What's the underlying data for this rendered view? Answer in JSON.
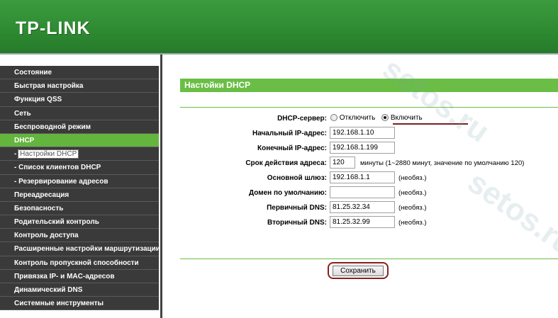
{
  "header": {
    "logo": "TP-LINK"
  },
  "sidebar": {
    "items": [
      {
        "label": "Состояние",
        "active": false
      },
      {
        "label": "Быстрая настройка",
        "active": false
      },
      {
        "label": "Функция QSS",
        "active": false
      },
      {
        "label": "Сеть",
        "active": false
      },
      {
        "label": "Беспроводной режим",
        "active": false
      },
      {
        "label": "DHCP",
        "active": true
      },
      {
        "label": "- Настройки DHCP",
        "active": false,
        "sub": true,
        "selected": true
      },
      {
        "label": "- Список клиентов DHCP",
        "active": false,
        "sub": true
      },
      {
        "label": "- Резервирование адресов",
        "active": false,
        "sub": true
      },
      {
        "label": "Переадресация",
        "active": false
      },
      {
        "label": "Безопасность",
        "active": false
      },
      {
        "label": "Родительский контроль",
        "active": false
      },
      {
        "label": "Контроль доступа",
        "active": false
      },
      {
        "label": "Расширенные настройки маршрутизации",
        "active": false
      },
      {
        "label": "Контроль пропускной способности",
        "active": false
      },
      {
        "label": "Привязка IP- и MAC-адресов",
        "active": false
      },
      {
        "label": "Динамический DNS",
        "active": false
      },
      {
        "label": "Системные инструменты",
        "active": false
      }
    ]
  },
  "main": {
    "title": "Настойки DHCP",
    "dhcp_server": {
      "label": "DHCP-сервер:",
      "off_label": "Отключить",
      "on_label": "Включить",
      "selected": "on"
    },
    "fields": {
      "start_ip": {
        "label": "Начальный IP-адрес:",
        "value": "192.168.1.10"
      },
      "end_ip": {
        "label": "Конечный IP-адрес:",
        "value": "192.168.1.199"
      },
      "lease": {
        "label": "Срок действия адреса:",
        "value": "120",
        "note": "минуты (1~2880 минут, значение по умолчанию 120)"
      },
      "gateway": {
        "label": "Основной шлюз:",
        "value": "192.168.1.1",
        "note": "(необяз.)"
      },
      "domain": {
        "label": "Домен по умолчанию:",
        "value": "",
        "note": "(необяз.)"
      },
      "dns1": {
        "label": "Первичный DNS:",
        "value": "81.25.32.34",
        "note": "(необяз.)"
      },
      "dns2": {
        "label": "Вторичный DNS:",
        "value": "81.25.32.99",
        "note": "(необяз.)"
      }
    },
    "save_label": "Сохранить"
  },
  "watermark": "setos.ru",
  "colors": {
    "header": "#2f8b32",
    "accent": "#6abe45",
    "menu_bg": "#3a3a3a",
    "highlight": "#8b1e1e"
  }
}
